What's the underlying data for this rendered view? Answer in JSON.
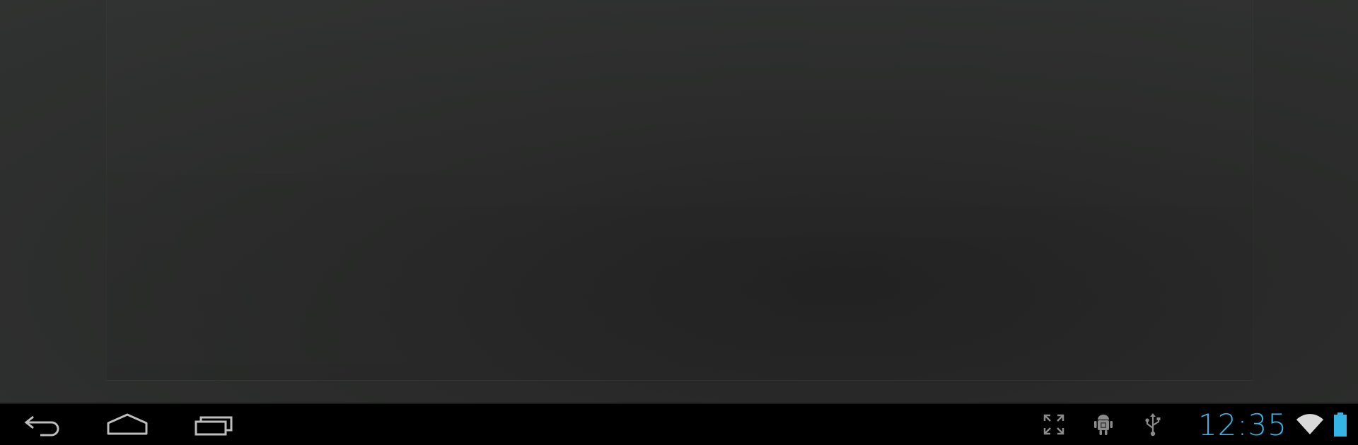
{
  "status_bar": {
    "clock": "12:35"
  },
  "icons": {
    "back": "back-arrow-icon",
    "home": "home-icon",
    "recents": "recent-apps-icon",
    "screenshot": "fullscreen-expand-icon",
    "debug": "android-debug-icon",
    "usb": "usb-icon",
    "wifi": "wifi-icon",
    "battery": "battery-icon"
  },
  "colors": {
    "accent": "#33b5e5",
    "nav_icon": "#bdbdbd",
    "status_icon": "#8a8a8a",
    "bar_background": "#000000",
    "content_background": "#2c2d2c"
  }
}
